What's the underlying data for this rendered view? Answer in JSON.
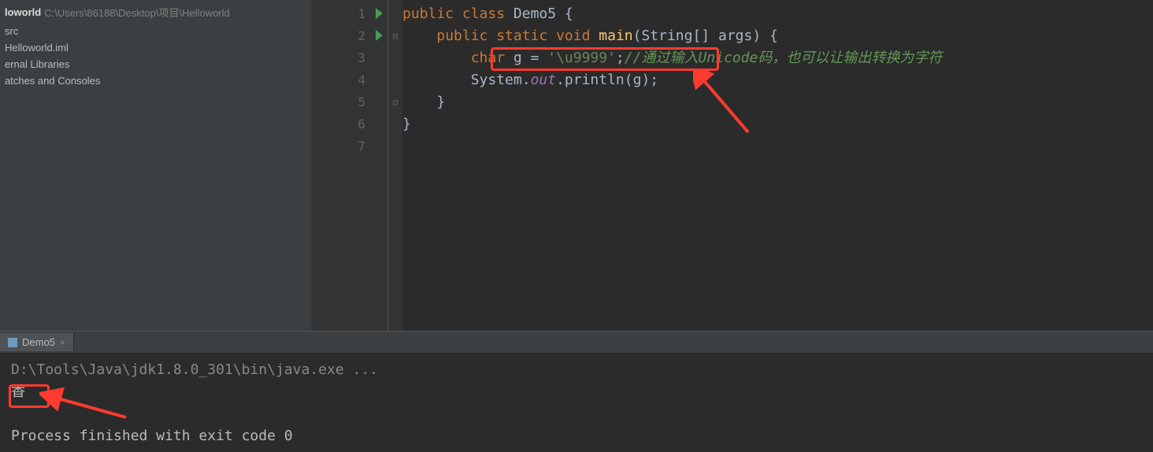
{
  "sidebar": {
    "project_name": "loworld",
    "project_path": "C:\\Users\\86188\\Desktop\\项目\\Helloworld",
    "items": [
      "src",
      "Helloworld.iml",
      "ernal Libraries",
      "atches and Consoles"
    ]
  },
  "editor": {
    "lines": [
      1,
      2,
      3,
      4,
      5,
      6,
      7
    ],
    "code": {
      "l1": {
        "kw1": "public ",
        "kw2": "class ",
        "name": "Demo5 ",
        "brace": "{"
      },
      "l2": {
        "kw1": "public static ",
        "kw2": "void ",
        "m": "main",
        "p": "(String[] args) {"
      },
      "l3": {
        "kw": "char ",
        "v": "g = ",
        "s": "'\\u9999'",
        "semi": ";",
        "c": "//通过输入Unicode码，也可以让输出转换为字符"
      },
      "l4": {
        "a": "System.",
        "f": "out",
        "b": ".println(g);"
      },
      "l5": {
        "t": "}"
      },
      "l6": {
        "t": "}"
      },
      "l7": {
        "t": ""
      }
    }
  },
  "consoleTab": {
    "label": "Demo5"
  },
  "console": {
    "path": "D:\\Tools\\Java\\jdk1.8.0_301\\bin\\java.exe ...",
    "output": "香",
    "exit": "Process finished with exit code 0"
  }
}
